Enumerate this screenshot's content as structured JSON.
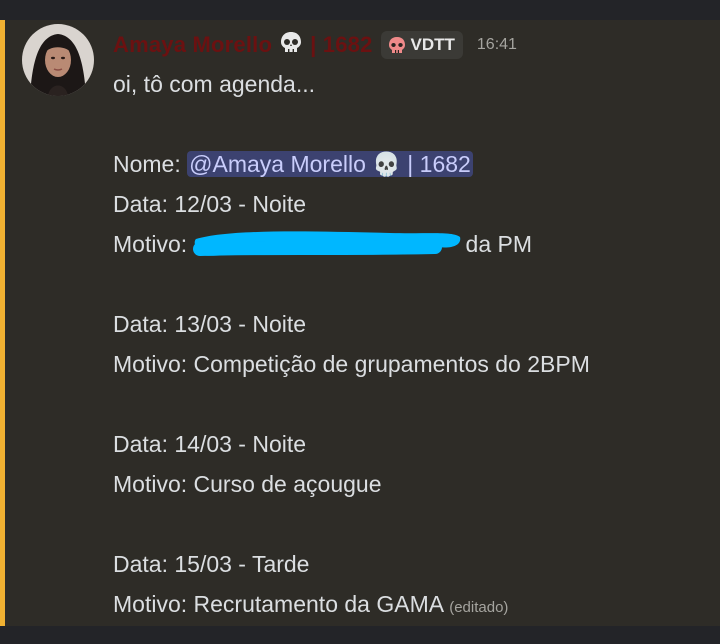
{
  "message": {
    "author": {
      "name": "Amaya Morello",
      "id_suffix": "| 1682",
      "tag": "VDTT",
      "name_color": "#6b1111"
    },
    "timestamp": "16:41",
    "lines": {
      "intro": "oi, tô com agenda...",
      "nome_label": "Nome: ",
      "mention": "@Amaya Morello 💀 | 1682",
      "data1": "Data: 12/03 - Noite",
      "motivo1_label": "Motivo: ",
      "motivo1_tail": "da PM",
      "data2": "Data: 13/03 - Noite",
      "motivo2": "Motivo: Competição de grupamentos do 2BPM",
      "data3": "Data: 14/03 - Noite",
      "motivo3": "Motivo: Curso de açougue",
      "data4": "Data: 15/03 - Tarde",
      "motivo4": "Motivo: Recrutamento da GAMA "
    },
    "edited_label": "(editado)",
    "icons": {
      "name_emoji": "skull-icon",
      "tag_emoji": "pig-skull-icon"
    },
    "colors": {
      "mention_stripe": "#f0b132",
      "redaction": "#00b7ff"
    }
  }
}
